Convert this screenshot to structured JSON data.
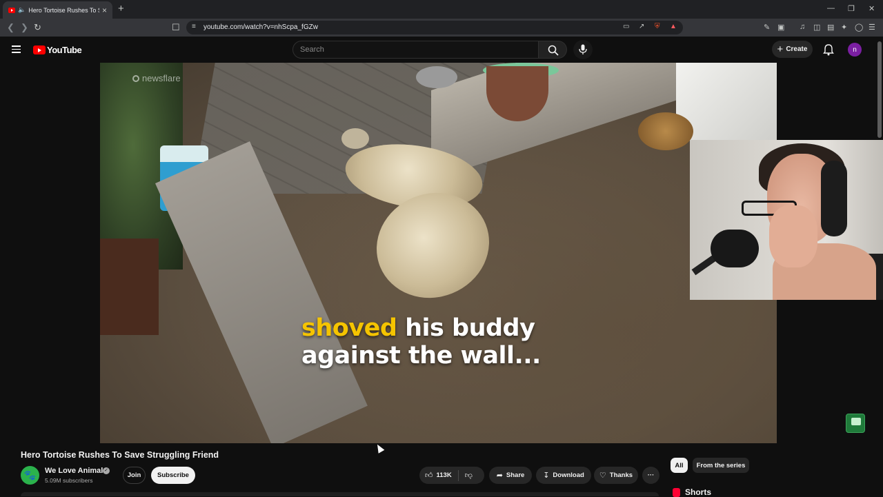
{
  "browser": {
    "tab_title": "Hero Tortoise Rushes To Save Struggling Friend",
    "url": "youtube.com/watch?v=nhScpa_fGZw"
  },
  "youtube": {
    "logo_text": "YouTube",
    "search_placeholder": "Search",
    "create_label": "Create",
    "avatar_letter": "n"
  },
  "video": {
    "watermark": "newsflare",
    "caption_highlight": "shoved",
    "caption_rest_line1": " his buddy",
    "caption_line2": "against the wall...",
    "title": "Hero Tortoise Rushes To Save Struggling Friend"
  },
  "channel": {
    "name": "We Love Animals",
    "subscribers": "5.09M subscribers",
    "join_label": "Join",
    "subscribe_label": "Subscribe"
  },
  "actions": {
    "like_count": "113K",
    "share_label": "Share",
    "download_label": "Download",
    "thanks_label": "Thanks",
    "more_label": "···"
  },
  "sidebar": {
    "chips": [
      "All",
      "From the series"
    ],
    "shorts_label": "Shorts"
  },
  "colors": {
    "youtube_red": "#ff0000",
    "caption_highlight": "#f5c400",
    "avatar_bg": "#7b1fa2"
  }
}
